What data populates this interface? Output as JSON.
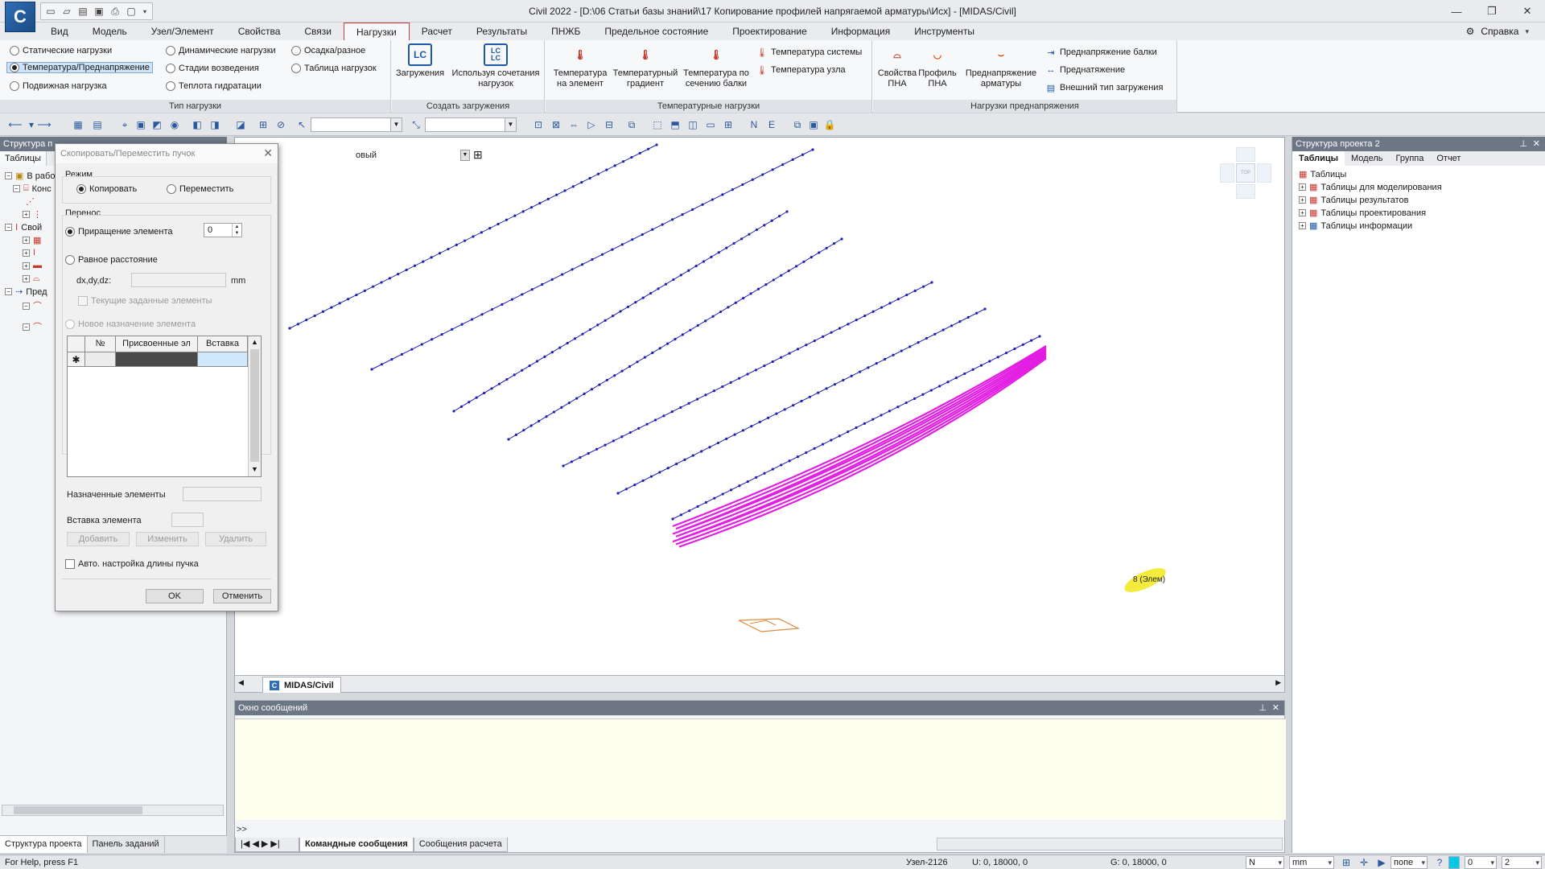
{
  "titlebar": {
    "title": "Civil 2022 - [D:\\06 Статьи базы знаний\\17 Копирование профилей напрягаемой арматуры\\Исх] - [MIDAS/Civil]",
    "logo": "C"
  },
  "menu": {
    "tabs": [
      "Вид",
      "Модель",
      "Узел/Элемент",
      "Свойства",
      "Связи",
      "Нагрузки",
      "Расчет",
      "Результаты",
      "ПНЖБ",
      "Предельное состояние",
      "Проектирование",
      "Информация",
      "Инструменты"
    ],
    "active": "Нагрузки",
    "help_label": "Справка"
  },
  "ribbon": {
    "load_type": {
      "label": "Тип нагрузки",
      "options": [
        "Статические нагрузки",
        "Динамические нагрузки",
        "Осадка/разное",
        "Температура/Преднапряжение",
        "Стадии возведения",
        "Таблица нагрузок",
        "Подвижная нагрузка",
        "Теплота гидратации"
      ],
      "selected": "Температура/Преднапряжение"
    },
    "create_loads": {
      "label": "Создать загружения",
      "btn_loadcases": "Загружения",
      "btn_combinations": "Используя сочетания нагрузок",
      "icon_lc": "LC",
      "icon_lclc": "LC LC"
    },
    "temp_loads": {
      "label": "Температурные нагрузки",
      "btn_element": "Температура на элемент",
      "btn_gradient": "Температурный градиент",
      "btn_section": "Температура по сечению балки",
      "btn_system": "Температура системы",
      "btn_node": "Температура узла"
    },
    "prestress": {
      "label": "Нагрузки преднапряжения",
      "btn_props": "Свойства ПНА",
      "btn_profile": "Профиль ПНА",
      "btn_arm": "Преднапряжение арматуры",
      "btn_beam": "Преднапряжение балки",
      "btn_pretension": "Преднатяжение",
      "btn_external": "Внешний тип загружения"
    }
  },
  "left_panel": {
    "header": "Структура п",
    "tab": "Таблицы",
    "tree": [
      "В работе",
      "Конс",
      "Свой",
      "Пред"
    ],
    "bottom_tabs": [
      "Структура проекта",
      "Панель заданий"
    ]
  },
  "dialog": {
    "title": "Скопировать/Переместить пучок",
    "mode_label": "Режим",
    "copy_label": "Копировать",
    "move_label": "Переместить",
    "mode_selected": "copy",
    "transfer_label": "Перенос",
    "increment_label": "Приращение элемента",
    "increment_value": "0",
    "equal_dist_label": "Равное расстояние",
    "dxdydz_label": "dx,dy,dz:",
    "unit_mm": "mm",
    "current_elements_label": "Текущие заданные элементы",
    "new_assign_label": "Новое назначение элемента",
    "grid_headers": [
      "№",
      "Присвоенные эл",
      "Вставка"
    ],
    "new_row_marker": "✱",
    "assigned_label": "Назначенные элементы",
    "insert_label": "Вставка элемента",
    "add_btn": "Добавить",
    "edit_btn": "Изменить",
    "delete_btn": "Удалить",
    "auto_len_label": "Авто. настройка длины пучка",
    "ok_btn": "OK",
    "cancel_btn": "Отменить"
  },
  "view": {
    "combo_text": "овый",
    "tab_label": "MIDAS/Civil",
    "selection_label": "8 (Элем)",
    "colors": {
      "beam": "#1f1fb4",
      "tendon": "#e21ee2",
      "support": "#e08a3c",
      "highlight": "#f2e81a"
    }
  },
  "messages": {
    "header": "Окно сообщений",
    "prompt": ">>",
    "tabs": [
      "Командные сообщения",
      "Сообщения расчета"
    ]
  },
  "right_panel": {
    "header": "Структура проекта  2",
    "tabs": [
      "Таблицы",
      "Модель",
      "Группа",
      "Отчет"
    ],
    "tree_root": "Таблицы",
    "tree_items": [
      "Таблицы для моделирования",
      "Таблицы результатов",
      "Таблицы проектирования",
      "Таблицы информации"
    ]
  },
  "status": {
    "help": "For Help, press F1",
    "node": "Узел-2126",
    "u": "U: 0, 18000, 0",
    "g": "G: 0, 18000, 0",
    "dir": "N",
    "unit": "mm",
    "mode": "попе",
    "field1": "0",
    "field2": "2"
  }
}
